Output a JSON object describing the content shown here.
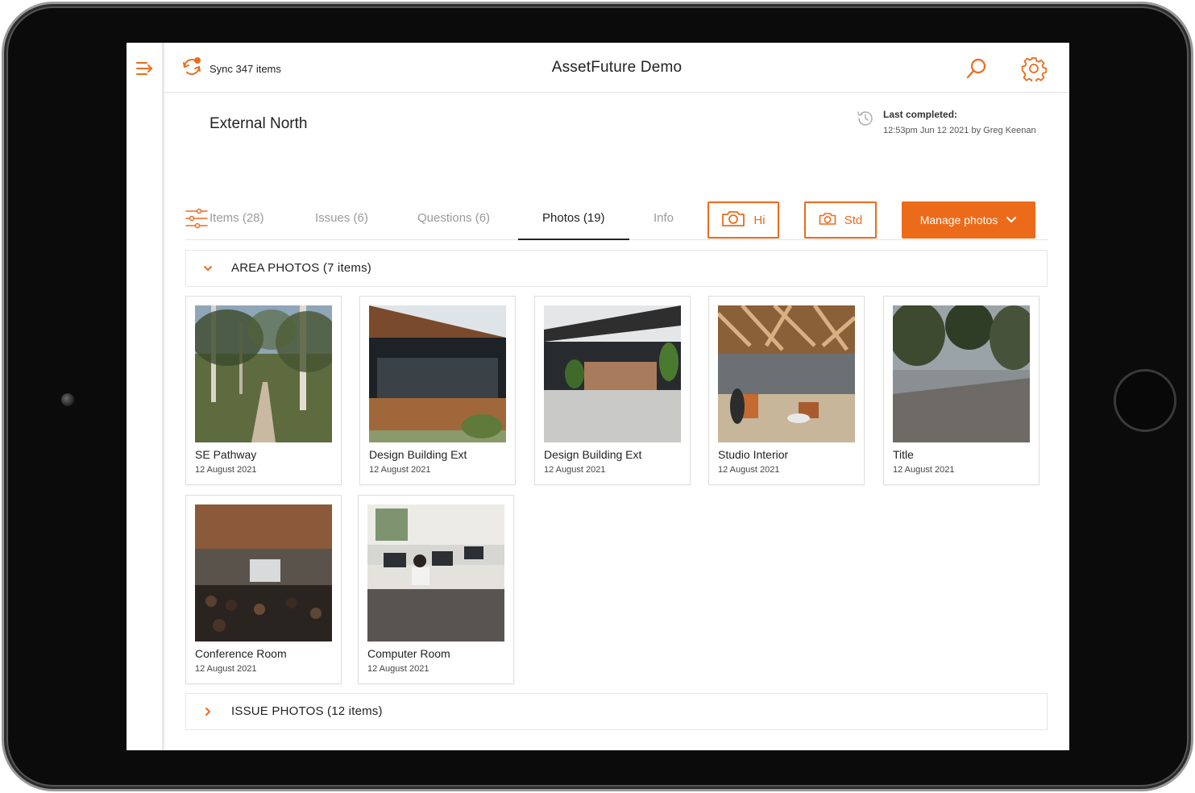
{
  "app": {
    "title": "AssetFuture Demo"
  },
  "sync": {
    "label": "Sync 347 items"
  },
  "area": {
    "title": "External North",
    "last_completed_label": "Last completed:",
    "last_completed_detail": "12:53pm Jun 12 2021 by Greg Keenan"
  },
  "tabs": [
    {
      "label": "Items (28)",
      "active": false
    },
    {
      "label": "Issues (6)",
      "active": false
    },
    {
      "label": "Questions (6)",
      "active": false
    },
    {
      "label": "Photos (19)",
      "active": true
    },
    {
      "label": "Info",
      "active": false
    }
  ],
  "toolbar": {
    "hi_label": "Hi",
    "std_label": "Std",
    "manage_label": "Manage photos"
  },
  "sections": [
    {
      "label": "AREA PHOTOS (7 items)",
      "expanded": true
    },
    {
      "label": "ISSUE PHOTOS (12 items)",
      "expanded": false
    }
  ],
  "photos": [
    {
      "name": "SE Pathway",
      "date": "12 August 2021"
    },
    {
      "name": "Design Building Ext",
      "date": "12 August 2021"
    },
    {
      "name": "Design Building Ext",
      "date": "12 August 2021"
    },
    {
      "name": "Studio Interior",
      "date": "12 August 2021"
    },
    {
      "name": "Title",
      "date": "12 August 2021"
    },
    {
      "name": "Conference Room",
      "date": "12 August 2021"
    },
    {
      "name": "Computer Room",
      "date": "12 August 2021"
    }
  ],
  "colors": {
    "accent": "#ec6b1b",
    "text": "#222222",
    "muted": "#9a9a9a"
  },
  "icons": [
    "menu-collapse-icon",
    "sync-icon",
    "search-icon",
    "gear-icon",
    "history-icon",
    "filter-sliders-icon",
    "camera-icon",
    "chevron-down-icon",
    "chevron-right-icon"
  ]
}
